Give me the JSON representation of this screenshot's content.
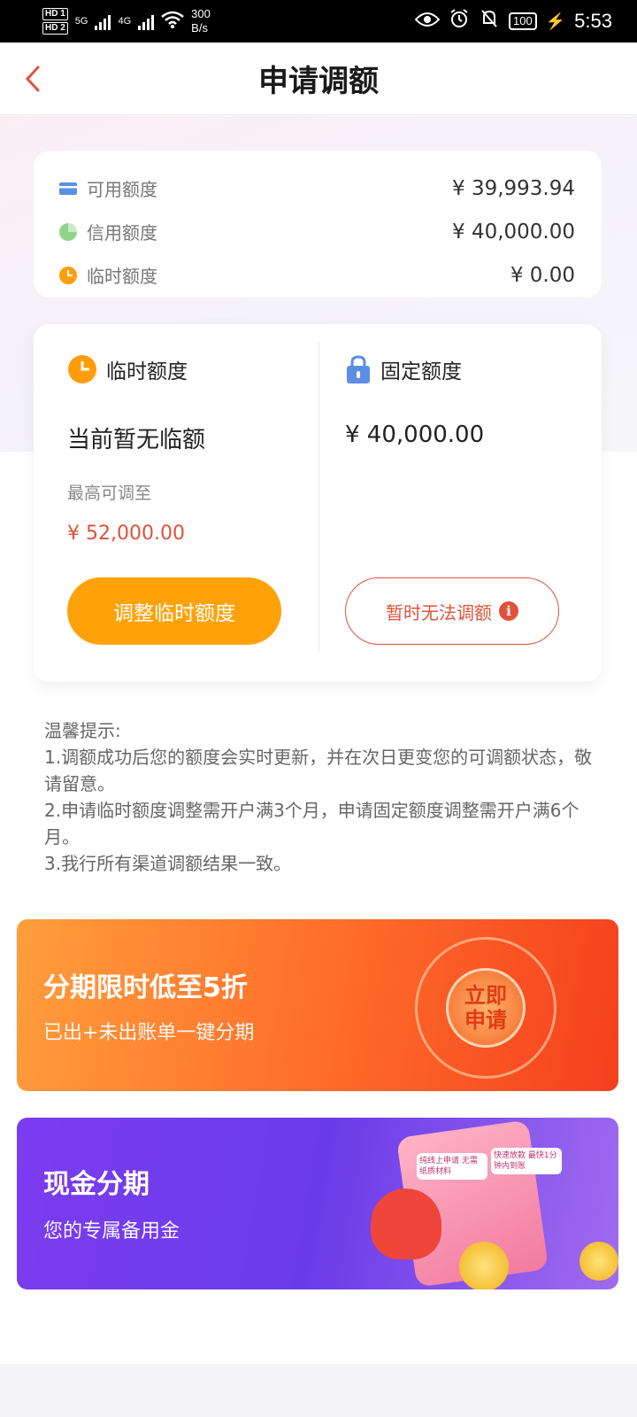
{
  "status_bar": {
    "hd1": "HD 1",
    "hd2": "HD 2",
    "sig1": "5G",
    "sig2": "4G",
    "speed_value": "300",
    "speed_unit": "B/s",
    "battery": "100",
    "time": "5:53"
  },
  "header": {
    "title": "申请调额"
  },
  "summary": {
    "rows": [
      {
        "label": "可用额度",
        "value": "¥ 39,993.94",
        "icon": "card-icon",
        "color": "#5b8fe6"
      },
      {
        "label": "信用额度",
        "value": "¥ 40,000.00",
        "icon": "pie-icon",
        "color": "#8fd48a"
      },
      {
        "label": "临时额度",
        "value": "¥ 0.00",
        "icon": "clock-icon",
        "color": "#ff9d0a"
      }
    ]
  },
  "temp": {
    "label": "临时额度",
    "status": "当前暂无临额",
    "max_label": "最高可调至",
    "max_value": "¥ 52,000.00",
    "button": "调整临时额度"
  },
  "fixed": {
    "label": "固定额度",
    "value": "¥ 40,000.00",
    "button": "暂时无法调额"
  },
  "tips": {
    "title": "温馨提示:",
    "items": [
      "1.调额成功后您的额度会实时更新，并在次日更变您的可调额状态，敬请留意。",
      "2.申请临时额度调整需开户满3个月，申请固定额度调整需开户满6个月。",
      "3.我行所有渠道调额结果一致。"
    ]
  },
  "banner1": {
    "title": "分期限时低至5折",
    "subtitle": "已出+未出账单一键分期",
    "stamp": "立即申请"
  },
  "banner2": {
    "title": "现金分期",
    "subtitle": "您的专属备用金",
    "tag1": "纯线上申请 无需纸质材料",
    "tag2": "快速放款 最快1分钟内到账"
  },
  "colors": {
    "accent_orange": "#ffa20a",
    "accent_red": "#e0533b"
  }
}
